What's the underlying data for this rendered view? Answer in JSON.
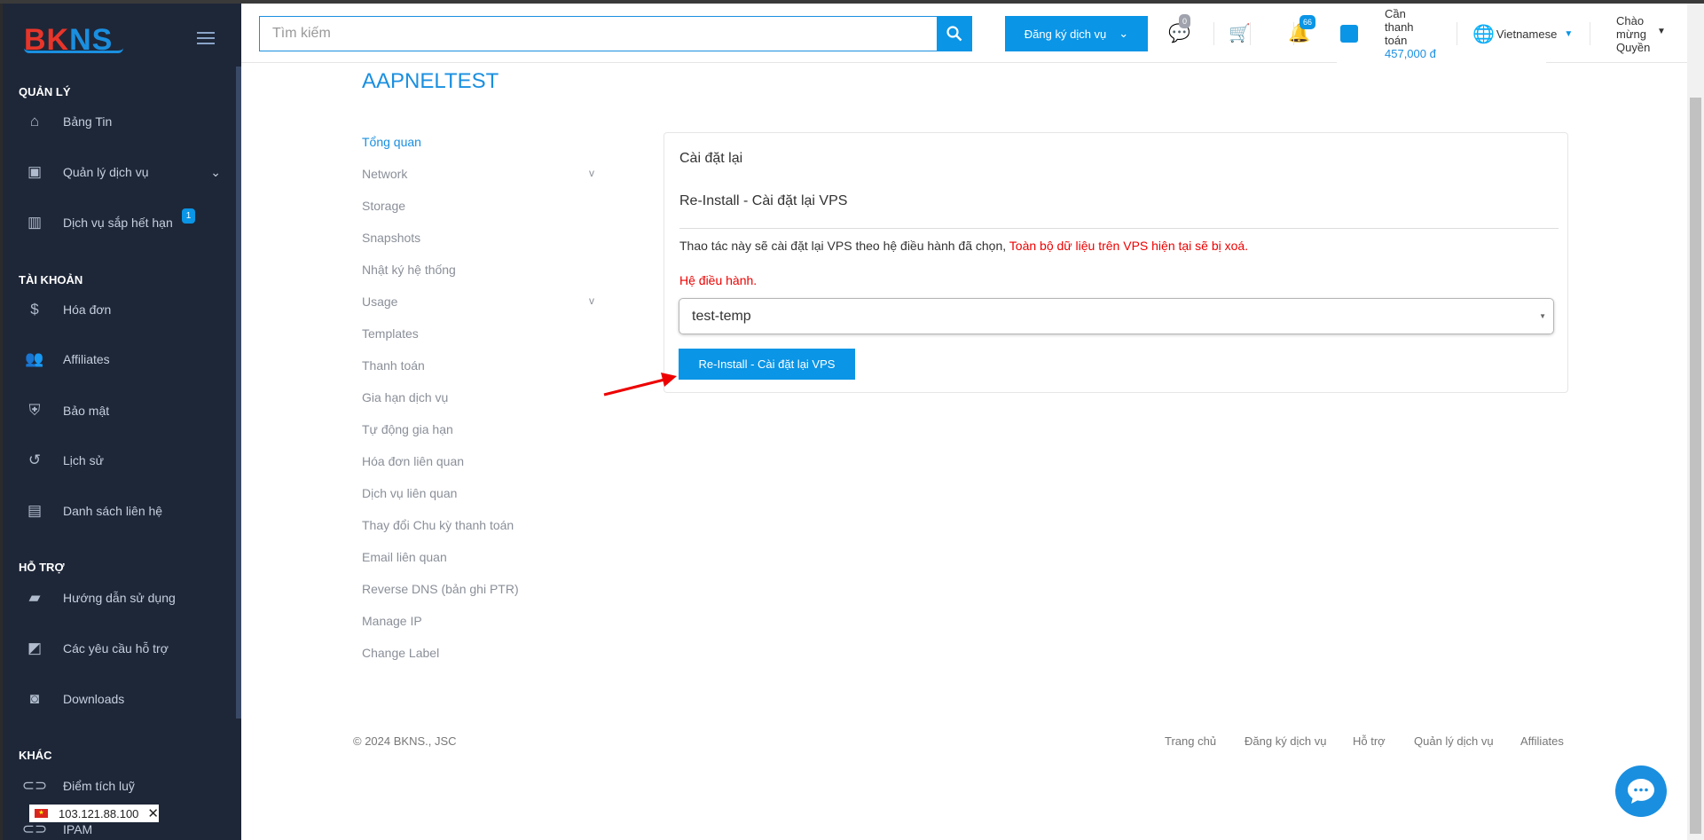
{
  "brand": {
    "logo_b": "BK",
    "logo_n": "NS",
    "accent": "#0a95e6"
  },
  "sidebar": {
    "sections": [
      {
        "title": "QUẢN LÝ"
      },
      {
        "title": "TÀI KHOẢN"
      },
      {
        "title": "HỖ TRỢ"
      },
      {
        "title": "KHÁC"
      }
    ],
    "items": [
      {
        "label": "Bảng Tin",
        "icon": "home-icon"
      },
      {
        "label": "Quản lý dịch vụ",
        "icon": "contact-card-icon"
      },
      {
        "label": "Dịch vụ sắp hết hạn",
        "icon": "bar-chart-icon",
        "badge": "1"
      },
      {
        "label": "Hóa đơn",
        "icon": "dollar-icon"
      },
      {
        "label": "Affiliates",
        "icon": "user-add-icon"
      },
      {
        "label": "Bảo mật",
        "icon": "shield-icon"
      },
      {
        "label": "Lịch sử",
        "icon": "history-icon"
      },
      {
        "label": "Danh sách liên hệ",
        "icon": "contacts-icon"
      },
      {
        "label": "Hướng dẫn sử dụng",
        "icon": "label-icon"
      },
      {
        "label": "Các yêu cầu hỗ trợ",
        "icon": "ticket-icon"
      },
      {
        "label": "Downloads",
        "icon": "save-icon"
      },
      {
        "label": "Điểm tích luỹ",
        "icon": "link-icon"
      },
      {
        "label": "IPAM",
        "icon": "link-icon"
      }
    ]
  },
  "ip_tooltip": {
    "ip": "103.121.88.100"
  },
  "header": {
    "search_placeholder": "Tìm kiếm",
    "register_label": "Đăng ký dịch vụ",
    "messages_count": "0",
    "notifications_count": "66",
    "payment_label_1": "Cần",
    "payment_label_2": "thanh",
    "payment_label_3": "toán",
    "payment_amount": "457,000 đ",
    "language": "Vietnamese",
    "welcome_1": "Chào",
    "welcome_2": "mừng",
    "welcome_3": "Quyền"
  },
  "main": {
    "title": "AAPNELTEST",
    "nav": [
      {
        "label": "Tổng quan",
        "active": true
      },
      {
        "label": "Network",
        "chevron": "v"
      },
      {
        "label": "Storage"
      },
      {
        "label": "Snapshots"
      },
      {
        "label": "Nhật ký hệ thống"
      },
      {
        "label": "Usage",
        "chevron": "v"
      },
      {
        "label": "Templates"
      },
      {
        "label": "Thanh toán"
      },
      {
        "label": "Gia hạn dịch vụ"
      },
      {
        "label": "Tự động gia hạn"
      },
      {
        "label": "Hóa đơn liên quan"
      },
      {
        "label": "Dịch vụ liên quan"
      },
      {
        "label": "Thay đổi Chu kỳ thanh toán"
      },
      {
        "label": "Email liên quan"
      },
      {
        "label": "Reverse DNS (bản ghi PTR)"
      },
      {
        "label": "Manage IP"
      },
      {
        "label": "Change Label"
      }
    ],
    "card": {
      "heading": "Cài đặt lại",
      "subheading": "Re-Install - Cài đặt lại VPS",
      "desc": "Thao tác này sẽ cài đặt lại VPS theo hệ điều hành đã chọn, ",
      "warning": "Toàn bộ dữ liệu trên VPS hiện tại sẽ bị xoá.",
      "os_label": "Hệ điều hành.",
      "os_selected": "test-temp",
      "button": "Re-Install - Cài đặt lại VPS"
    }
  },
  "footer": {
    "copyright": "© 2024 BKNS., JSC",
    "links": [
      "Trang chủ",
      "Đăng ký dịch vụ",
      "Hỗ trợ",
      "Quản lý dịch vụ",
      "Affiliates"
    ]
  }
}
